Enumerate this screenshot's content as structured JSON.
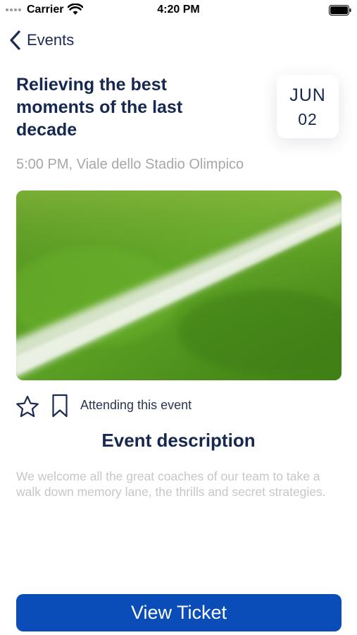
{
  "status_bar": {
    "carrier": "Carrier",
    "time": "4:20 PM"
  },
  "nav": {
    "back_label": "Events"
  },
  "event": {
    "title": "Relieving the best moments of the last decade",
    "date_month": "JUN",
    "date_day": "02",
    "meta": "5:00 PM, Viale dello Stadio Olimpico",
    "image_icon": "football-pitch-photo"
  },
  "actions": {
    "attending_label": "Attending this event"
  },
  "description": {
    "heading": "Event description",
    "text": "We welcome all the great coaches of our team to take a walk down memory lane, the thrills and secret strategies."
  },
  "cta": {
    "view_ticket_label": "View Ticket"
  },
  "colors": {
    "primary": "#0b4db8",
    "title": "#16284f",
    "muted": "#a7a7a7"
  }
}
